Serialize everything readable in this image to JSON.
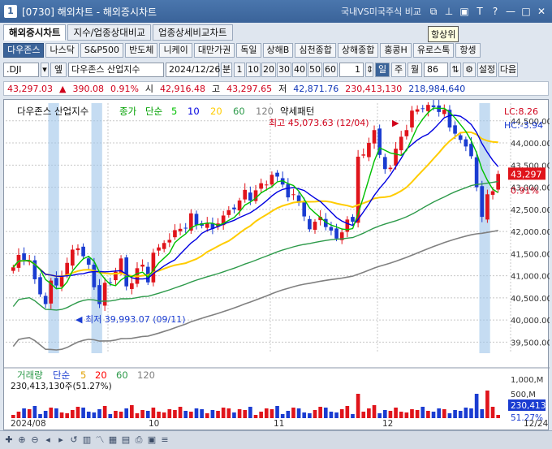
{
  "window": {
    "app_number": "1",
    "title": "[0730] 해외차트 - 해외증시차트",
    "mid_label": "국내VS미국주식 비교"
  },
  "tabs": [
    {
      "label": "해외증시차트",
      "active": true
    },
    {
      "label": "지수/업종상대비교",
      "active": false
    },
    {
      "label": "업종상세비교차트",
      "active": false
    }
  ],
  "tooltip": "항상위",
  "markets": [
    {
      "label": "다우존스",
      "active": true
    },
    {
      "label": "나스닥"
    },
    {
      "label": "S&P500"
    },
    {
      "label": "반도체"
    },
    {
      "label": "니케이"
    },
    {
      "label": "대만가권"
    },
    {
      "label": "독일"
    },
    {
      "label": "상해B"
    },
    {
      "label": "심천종합"
    },
    {
      "label": "상해종합"
    },
    {
      "label": "홍콩H"
    },
    {
      "label": "유로스톡"
    },
    {
      "label": "항셍"
    }
  ],
  "toolbar": {
    "symbol": ".DJI",
    "search_label": "엪",
    "name": "다우존스 산업지수",
    "date": "2024/12/26",
    "unit_label": "분",
    "minutes": [
      "1",
      "10",
      "20",
      "30",
      "40",
      "50",
      "60"
    ],
    "count": "1",
    "periods": [
      "일",
      "주",
      "월"
    ],
    "period_count": "86",
    "settings": "설정",
    "next": "다음"
  },
  "price": {
    "last": "43,297.03",
    "arrow": "▲",
    "change": "390.08",
    "pct": "0.91%",
    "open_label": "시",
    "open": "42,916.48",
    "high_label": "고",
    "high": "43,297.65",
    "low_label": "저",
    "low": "42,871.76",
    "volume": "230,413,130",
    "amount": "218,984,640"
  },
  "chart_data": {
    "type": "candlestick",
    "title": "다우존스 산업지수",
    "legend": {
      "close_label": "종가",
      "ma_type": "단순",
      "ma": [
        {
          "period": "5",
          "color": "#00c000"
        },
        {
          "period": "10",
          "color": "#0000e0"
        },
        {
          "period": "20",
          "color": "#ffcc00"
        },
        {
          "period": "60",
          "color": "#2d9a4a"
        },
        {
          "period": "120",
          "color": "#808080"
        }
      ],
      "extra": "약세패턴"
    },
    "y_ticks": [
      "44,500.00",
      "44,000.00",
      "43,500.00",
      "43,000.00",
      "42,500.00",
      "42,000.00",
      "41,500.00",
      "41,000.00",
      "40,500.00",
      "40,000.00",
      "39,500.00"
    ],
    "ylim": [
      39250,
      44900
    ],
    "x_ticks": [
      "2024/08",
      "10",
      "11",
      "12",
      "12/24"
    ],
    "high_note": "최고 45,073.63 (12/04)",
    "low_note": "최저 39,993.07 (09/11)",
    "lc": "LC:8.26",
    "hc": "HC:-3.94",
    "last_label": "43,297",
    "last_pct": "0.91%",
    "closes": [
      41190,
      41470,
      41360,
      41350,
      40920,
      40580,
      40360,
      40890,
      40780,
      40980,
      41290,
      41590,
      41620,
      41440,
      41250,
      40740,
      40360,
      40840,
      40840,
      41090,
      41390,
      40760,
      40830,
      41170,
      41250,
      40850,
      41520,
      41640,
      41740,
      41810,
      42030,
      42060,
      42080,
      42410,
      42150,
      42130,
      42180,
      42060,
      42180,
      42360,
      42480,
      42500,
      42700,
      42940,
      42700,
      42930,
      43090,
      43060,
      43280,
      43240,
      43060,
      42770,
      42840,
      42650,
      42340,
      42050,
      42220,
      42330,
      42100,
      42020,
      41840,
      41980,
      42270,
      42220,
      43690,
      43740,
      44000,
      44290,
      43730,
      43410,
      43440,
      43870,
      44140,
      44290,
      44730,
      44760,
      44780,
      44860,
      44810,
      44700,
      44750,
      44350,
      44210,
      44070,
      43920,
      43700,
      43000,
      42330,
      42840,
      42910,
      43300
    ],
    "volume_legend": {
      "label": "거래량",
      "ma_type": "단순",
      "ma": [
        {
          "period": "5",
          "color": "#e0a000"
        },
        {
          "period": "20",
          "color": "#ff0000"
        },
        {
          "period": "60",
          "color": "#2d9a4a"
        },
        {
          "period": "120",
          "color": "#808080"
        }
      ],
      "value": "230,413,130주(51.27%)"
    },
    "vol_ticks": [
      "1,000,M",
      "500,M"
    ],
    "vol_last": "230,413",
    "vol_pct": "51.27%"
  }
}
